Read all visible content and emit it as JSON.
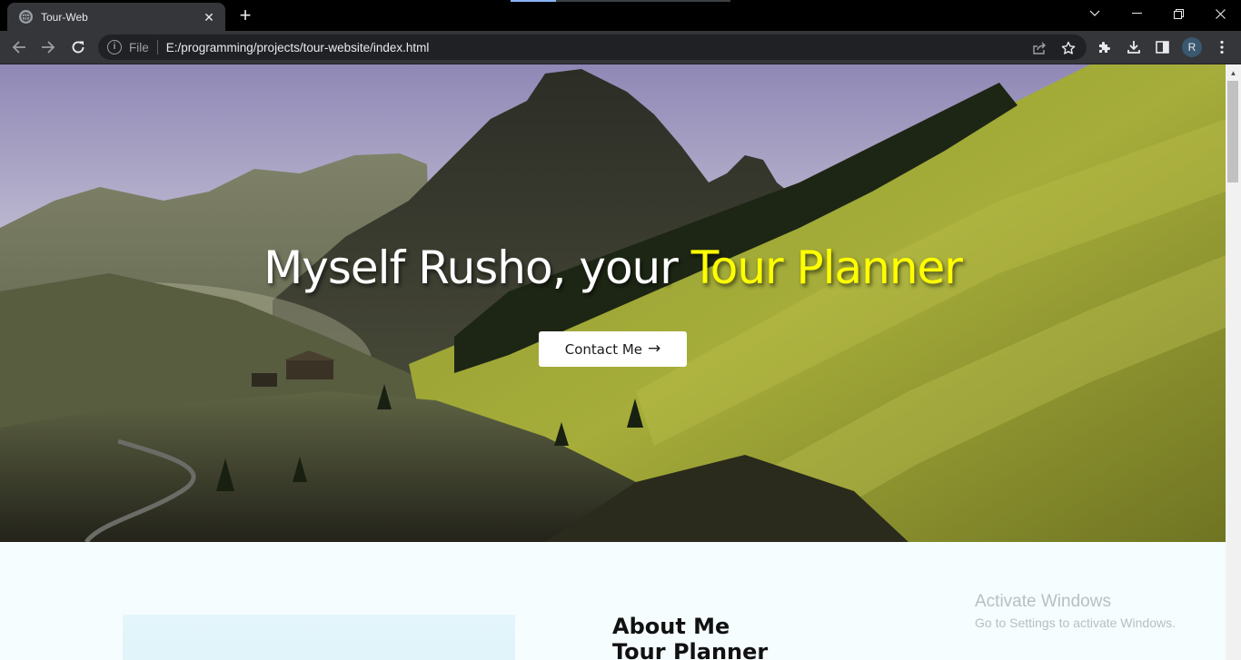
{
  "browser": {
    "tab_title": "Tour-Web",
    "tab_close": "✕",
    "new_tab": "+",
    "omnibox": {
      "scheme_label": "File",
      "url": "E:/programming/projects/tour-website/index.html"
    },
    "profile_initial": "R",
    "window_controls": {
      "dropdown": "⌄",
      "minimize": "—",
      "restore": "❐",
      "close": "✕"
    }
  },
  "page": {
    "hero": {
      "heading_prefix": "Myself Rusho, your ",
      "heading_accent": "Tour Planner",
      "cta_label": "Contact Me",
      "cta_arrow": "→"
    },
    "about": {
      "heading_line1": "About Me",
      "heading_line2": "Tour Planner"
    }
  },
  "overlay": {
    "activate_title": "Activate Windows",
    "activate_subtitle": "Go to Settings to activate Windows."
  },
  "colors": {
    "accent_yellow": "#ffff00",
    "chrome_dark": "#35363a",
    "page_bg": "#f5fdfe"
  },
  "icons": [
    "globe-icon",
    "back-arrow-icon",
    "forward-arrow-icon",
    "reload-icon",
    "info-icon",
    "share-icon",
    "star-icon",
    "puzzle-icon",
    "download-icon",
    "side-panel-icon",
    "kebab-menu-icon",
    "arrow-right-icon"
  ]
}
